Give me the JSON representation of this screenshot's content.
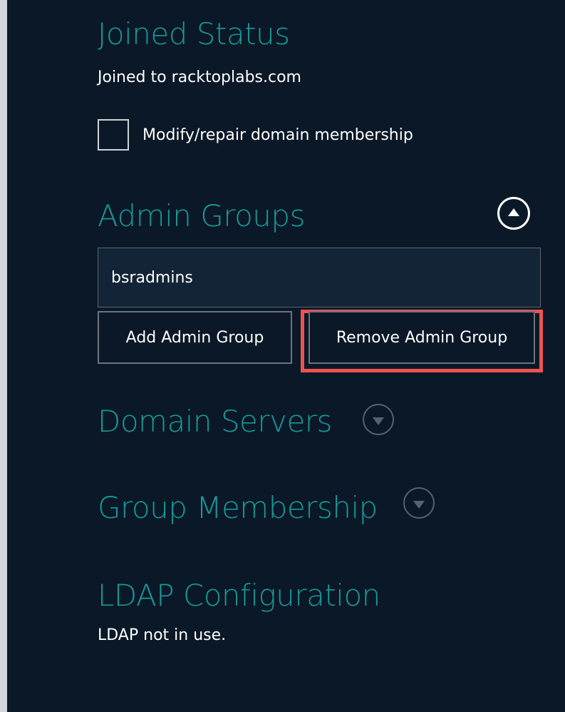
{
  "joined_status": {
    "heading": "Joined Status",
    "status_text": "Joined to racktoplabs.com",
    "modify_checkbox_label": "Modify/repair domain membership",
    "modify_checked": false
  },
  "admin_groups": {
    "heading": "Admin Groups",
    "collapse_icon": "chevron-up-circle-icon",
    "input_value": "bsradmins",
    "add_button_label": "Add Admin Group",
    "remove_button_label": "Remove Admin Group",
    "highlight_color": "#ef5252"
  },
  "domain_servers": {
    "heading": "Domain Servers",
    "expand_icon": "chevron-down-circle-icon"
  },
  "group_membership": {
    "heading": "Group Membership",
    "expand_icon": "chevron-down-circle-icon"
  },
  "ldap_configuration": {
    "heading": "LDAP Configuration",
    "status_text": "LDAP not in use."
  },
  "colors": {
    "background": "#0b1827",
    "heading_teal": "#169a99",
    "text_white": "#ffffff"
  }
}
